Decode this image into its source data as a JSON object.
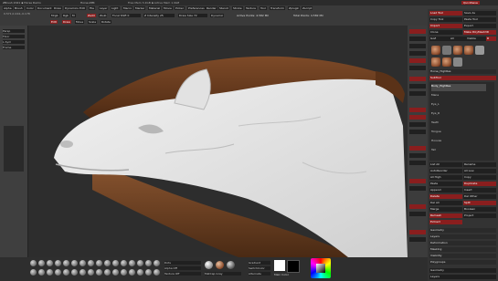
{
  "window": {
    "title": "ZBrush 2021 ▪ Horse Demo",
    "file": "Horse.ZPR",
    "mem": "Free Mem 3.2GB ▪ Active Mem 1.9GB",
    "quickmenu": "QuickSave",
    "menus": [
      "Alpha",
      "Brush",
      "Color",
      "Document",
      "Draw",
      "Dynamics",
      "Edit",
      "File",
      "Layer",
      "Light",
      "Macro",
      "Marker",
      "Material",
      "Movie",
      "Picker",
      "Preferences",
      "Render",
      "Stencil",
      "Stroke",
      "Texture",
      "Tool",
      "Transform",
      "Zplugin",
      "Zscript"
    ]
  },
  "toolbar": {
    "row1": [
      "Mrgb",
      "Rgb",
      "M",
      "Zadd",
      "Zsub",
      "Focal Shift 0",
      "Z Intensity 25",
      "Draw Size 72",
      "Dynamic",
      "Active Points: 4.582 Mil",
      "Total Points: 4.582 Mil"
    ],
    "row2": [
      "Edit",
      "Draw",
      "Move",
      "Scale",
      "Rotate"
    ],
    "coords": "0.571,0.244,-0.178"
  },
  "viewport": {
    "label": "Horse head sculpt"
  },
  "left_shelf": {
    "items": [
      "Persp",
      "Floor",
      "L.Sym",
      "Frame",
      "Move",
      "Scale",
      "Rotate",
      "PolyF",
      "Transp",
      "Solo"
    ]
  },
  "mid_shelf": {
    "items": [
      "BPR",
      "SPix 3",
      "Scroll",
      "Zoom",
      "Actual",
      "AAHalf",
      "Persp",
      "Floor",
      "L.Sym",
      "Frame",
      "Move",
      "Scale",
      "Rotate",
      "PolyF",
      "Transp",
      "Dynamic",
      "Solo"
    ]
  },
  "right_panel": {
    "header": [
      "Load Tool",
      "Save As",
      "Copy Tool",
      "Paste Tool",
      "Import",
      "Export",
      "Clone",
      "Make PolyMesh3D",
      "GoZ",
      "All",
      "Visible",
      "R"
    ],
    "current_tool": "Horse_HighRes",
    "subtools_title": "SubTool",
    "subtools": [
      "Body_HighRes",
      "Mane",
      "Eye_L",
      "Eye_R",
      "Teeth",
      "Tongue",
      "Hooves",
      "Tail"
    ],
    "subtool_selected": "Body_HighRes",
    "actions": [
      "List All",
      "Rename",
      "AutoReorder",
      "All Low",
      "All High",
      "Copy",
      "Paste",
      "Duplicate",
      "Append",
      "Insert",
      "Delete",
      "Del Other",
      "Del All",
      "Split",
      "Merge",
      "Boolean",
      "Remesh",
      "Project",
      "Extract"
    ],
    "sections": [
      "Geometry",
      "Layers",
      "Deformation",
      "Masking",
      "Visibility",
      "Polygroups"
    ],
    "bottom": [
      "Geometry",
      "Layers"
    ]
  },
  "bottom_shelf": {
    "brushes": [
      "Standard",
      "ClayBuildup",
      "Move",
      "DamStandard",
      "hPolish",
      "TrimDynamic",
      "Inflate",
      "Pinch",
      "Smooth",
      "Slash3",
      "Dam_Standard",
      "Clay",
      "Flatten",
      "MoveTopological",
      "SnakeHook",
      "CurveTube",
      "Planar",
      "Layer"
    ],
    "stroke": "Dots",
    "alpha": "Alpha Off",
    "texture": "Texture Off",
    "material": "MatCap Gray",
    "gradient_label": "Gradient",
    "switch_color": "SwitchColor",
    "alternate": "Alternate",
    "color_info": "Main Color"
  },
  "colors": {
    "accent_red": "#8a1e1e",
    "panel": "#3a3a3a",
    "viewport_bg": "#2d2d2d",
    "sculpt_white": "#e8e8e8",
    "mane_brown": "#6b3e22"
  }
}
